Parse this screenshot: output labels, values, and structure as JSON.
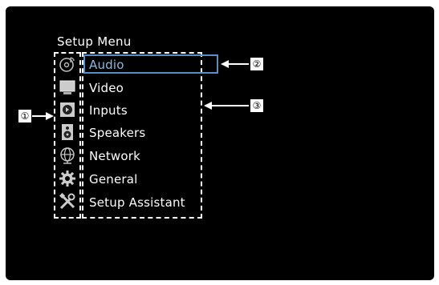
{
  "menu": {
    "title": "Setup Menu",
    "items": [
      {
        "label": "Audio",
        "icon": "audio-disc-icon",
        "selected": true
      },
      {
        "label": "Video",
        "icon": "monitor-icon",
        "selected": false
      },
      {
        "label": "Inputs",
        "icon": "input-icon",
        "selected": false
      },
      {
        "label": "Speakers",
        "icon": "speaker-icon",
        "selected": false
      },
      {
        "label": "Network",
        "icon": "globe-icon",
        "selected": false
      },
      {
        "label": "General",
        "icon": "gear-icon",
        "selected": false
      },
      {
        "label": "Setup Assistant",
        "icon": "tools-icon",
        "selected": false
      }
    ]
  },
  "callouts": {
    "one": "①",
    "two": "②",
    "three": "③"
  },
  "colors": {
    "screen": "#000000",
    "text": "#ffffff",
    "selected_text": "#8fb8de",
    "selection_border": "#5a8fc6"
  }
}
